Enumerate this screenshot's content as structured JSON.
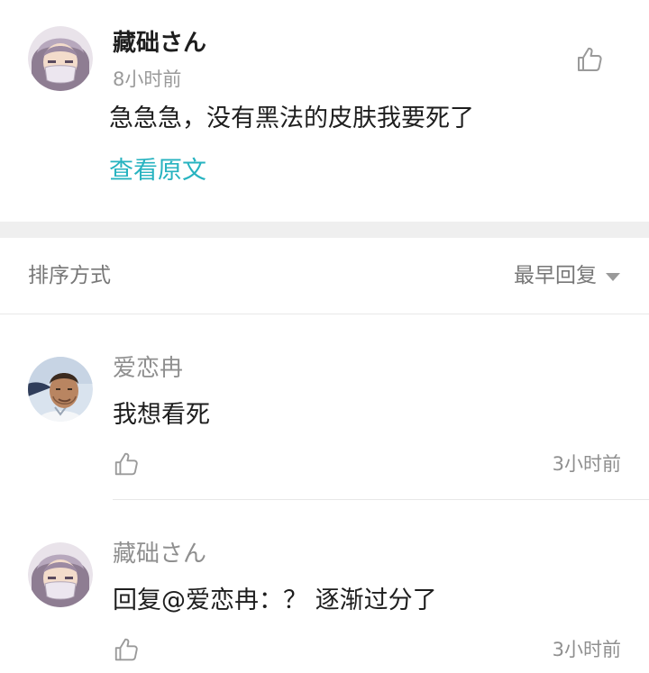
{
  "post": {
    "username": "藏础さん",
    "time": "8小时前",
    "content": "急急急，没有黑法的皮肤我要死了",
    "view_original": "查看原文",
    "avatar_icon": "anime-character-avatar",
    "like_icon": "thumbs-up-icon"
  },
  "sort": {
    "label": "排序方式",
    "selected": "最早回复"
  },
  "replies": [
    {
      "username": "爱恋冉",
      "content": "我想看死",
      "time": "3小时前",
      "avatar_icon": "person-photo-avatar"
    },
    {
      "username": "藏础さん",
      "reply_prefix": "回复",
      "mention": "@爱恋冉",
      "content": "：？ 逐渐过分了",
      "time": "3小时前",
      "avatar_icon": "anime-character-avatar"
    }
  ],
  "colors": {
    "link": "#27b3c0",
    "muted_text": "#8f8f8f",
    "band": "#efefef"
  }
}
